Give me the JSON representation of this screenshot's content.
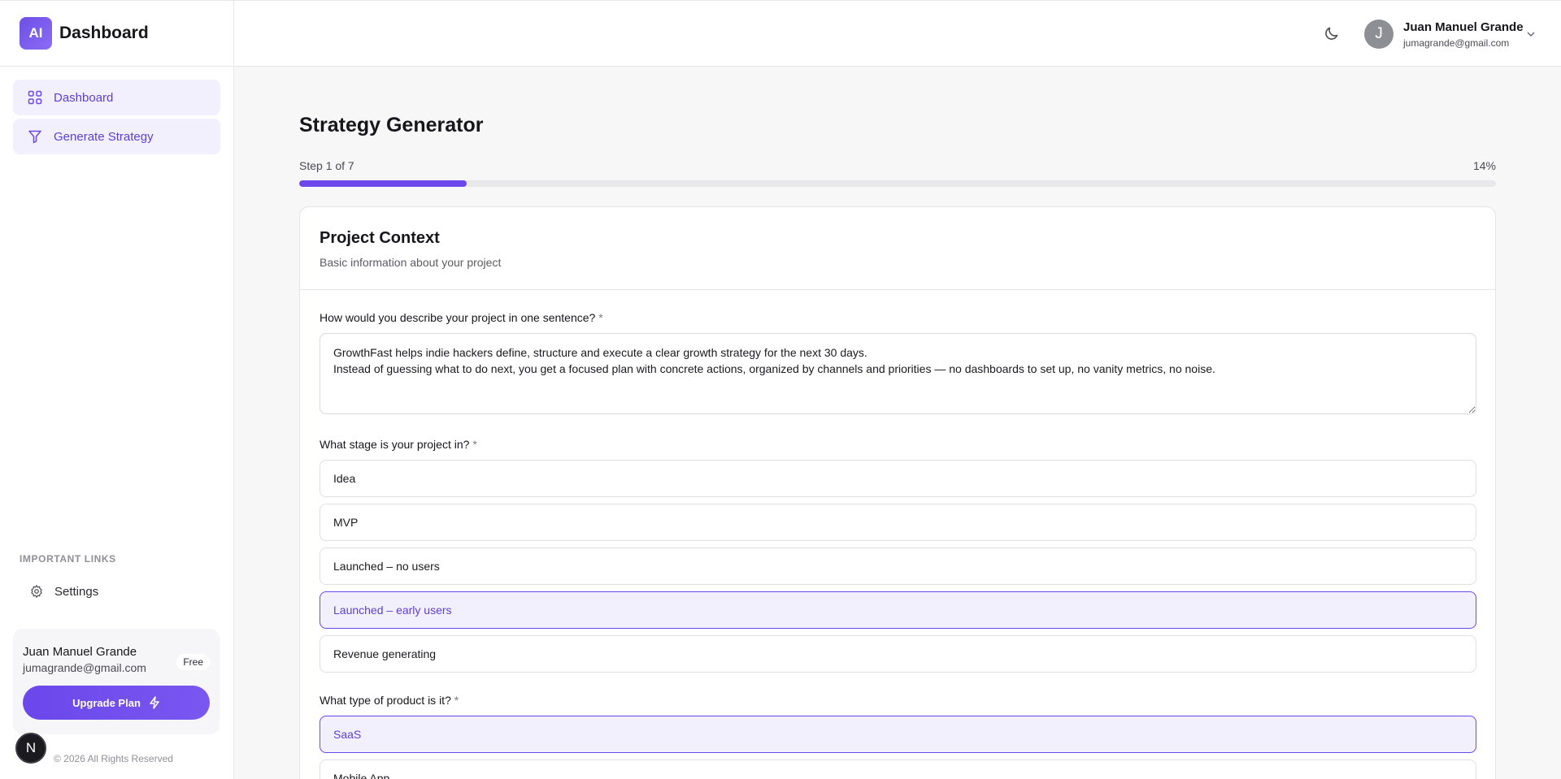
{
  "brand": {
    "logo": "AI",
    "title": "Dashboard"
  },
  "sidebar": {
    "nav": [
      {
        "label": "Dashboard",
        "icon": "grid-icon"
      },
      {
        "label": "Generate Strategy",
        "icon": "funnel-icon"
      }
    ],
    "links_heading": "IMPORTANT LINKS",
    "settings_label": "Settings",
    "user": {
      "name": "Juan Manuel Grande",
      "email": "jumagrande@gmail.com",
      "plan": "Free"
    },
    "upgrade_label": "Upgrade Plan",
    "copyright": "© 2026 All Rights Reserved",
    "n_badge": "N"
  },
  "header": {
    "avatar_initial": "J",
    "user_name": "Juan Manuel Grande",
    "user_email": "jumagrande@gmail.com"
  },
  "main": {
    "title": "Strategy Generator",
    "step_label": "Step 1 of 7",
    "progress_percent_label": "14%",
    "progress_fraction": 0.14,
    "card": {
      "title": "Project Context",
      "subtitle": "Basic information about your project",
      "q1": {
        "label": "How would you describe your project in one sentence?",
        "required": "*",
        "value": "GrowthFast helps indie hackers define, structure and execute a clear growth strategy for the next 30 days.\nInstead of guessing what to do next, you get a focused plan with concrete actions, organized by channels and priorities — no dashboards to set up, no vanity metrics, no noise."
      },
      "q2": {
        "label": "What stage is your project in?",
        "required": "*",
        "options": [
          "Idea",
          "MVP",
          "Launched – no users",
          "Launched – early users",
          "Revenue generating"
        ],
        "selected": "Launched – early users"
      },
      "q3": {
        "label": "What type of product is it?",
        "required": "*",
        "options": [
          "SaaS",
          "Mobile App"
        ],
        "selected": "SaaS"
      }
    }
  },
  "colors": {
    "accent": "#6b47ec",
    "accent_bg": "#f3f0fd"
  }
}
